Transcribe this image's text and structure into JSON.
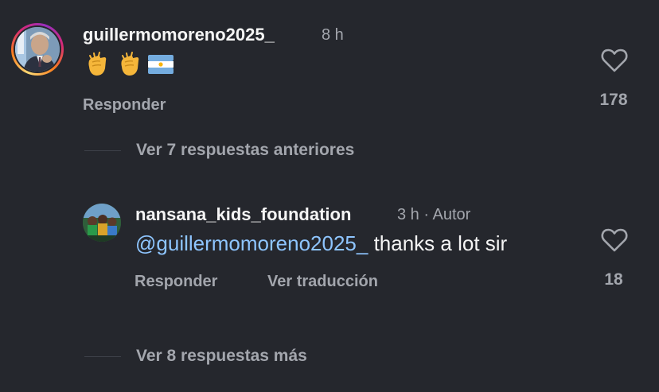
{
  "comment": {
    "username": "guillermomoreno2025_",
    "time": "8 h",
    "text_emojis": [
      "clapping-hands",
      "clapping-hands",
      "argentina-flag"
    ],
    "reply_label": "Responder",
    "like_count": "178",
    "avatar": "profile-photo-man-in-suit"
  },
  "previous_replies": {
    "label": "Ver 7 respuestas anteriores"
  },
  "reply": {
    "username": "nansana_kids_foundation",
    "time": "3 h",
    "separator": "·",
    "author_badge": "Autor",
    "mention": "@guillermomoreno2025_",
    "text": " thanks a lot sir",
    "reply_label": "Responder",
    "translate_label": "Ver traducción",
    "like_count": "18",
    "avatar": "profile-photo-group"
  },
  "more_replies": {
    "label": "Ver 8 respuestas más"
  },
  "colors": {
    "background": "#25272d",
    "primary_text": "#f5f5f5",
    "secondary_text": "#a3a6ad",
    "mention": "#8ec5ff"
  }
}
